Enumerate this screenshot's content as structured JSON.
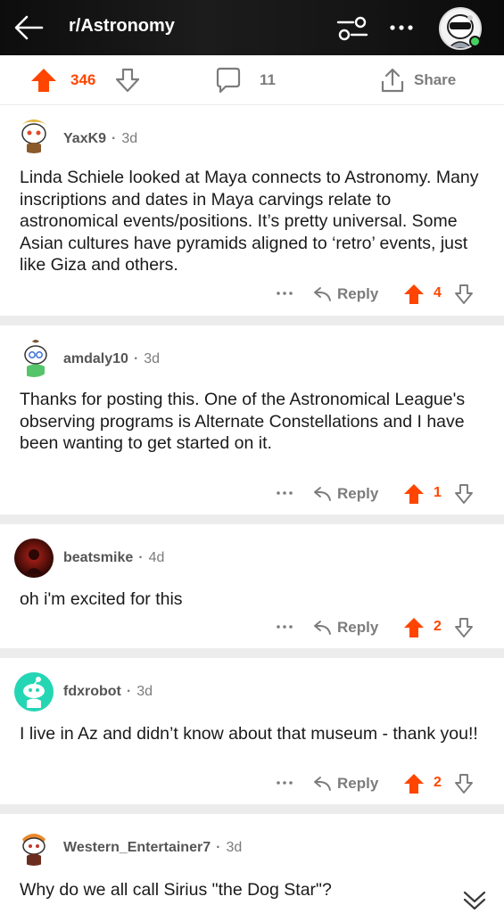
{
  "header": {
    "subreddit": "r/Astronomy",
    "back_icon": "arrow-left-icon",
    "filter_icon": "sliders-icon",
    "more_icon": "ellipsis-icon",
    "avatar_icon": "user-avatar"
  },
  "post_bar": {
    "score": "346",
    "comment_count": "11",
    "share_label": "Share"
  },
  "comments": [
    {
      "author": "YaxK9",
      "age": "3d",
      "body": "Linda Schiele looked at Maya connects to Astronomy. Many inscriptions and dates in Maya carvings relate to astronomical events/positions. It’s pretty universal. Some Asian cultures have pyramids aligned to ‘retro’ events, just like Giza and others.",
      "score": "4",
      "reply_label": "Reply"
    },
    {
      "author": "amdaly10",
      "age": "3d",
      "body": "Thanks for posting this.  One of the Astronomical League's observing programs is Alternate Constellations and I have been wanting to get started on it.",
      "score": "1",
      "reply_label": "Reply"
    },
    {
      "author": "beatsmike",
      "age": "4d",
      "body": "oh i'm excited for this",
      "score": "2",
      "reply_label": "Reply"
    },
    {
      "author": "fdxrobot",
      "age": "3d",
      "body": "I live in Az and didn’t know about that museum - thank you!!",
      "score": "2",
      "reply_label": "Reply"
    },
    {
      "author": "Western_Entertainer7",
      "age": "3d",
      "body": "Why do we all call Sirius \"the Dog Star\"?"
    }
  ],
  "colors": {
    "accent_upvote": "#ff4500",
    "muted": "#7c7c7c",
    "separator": "#ececec"
  }
}
